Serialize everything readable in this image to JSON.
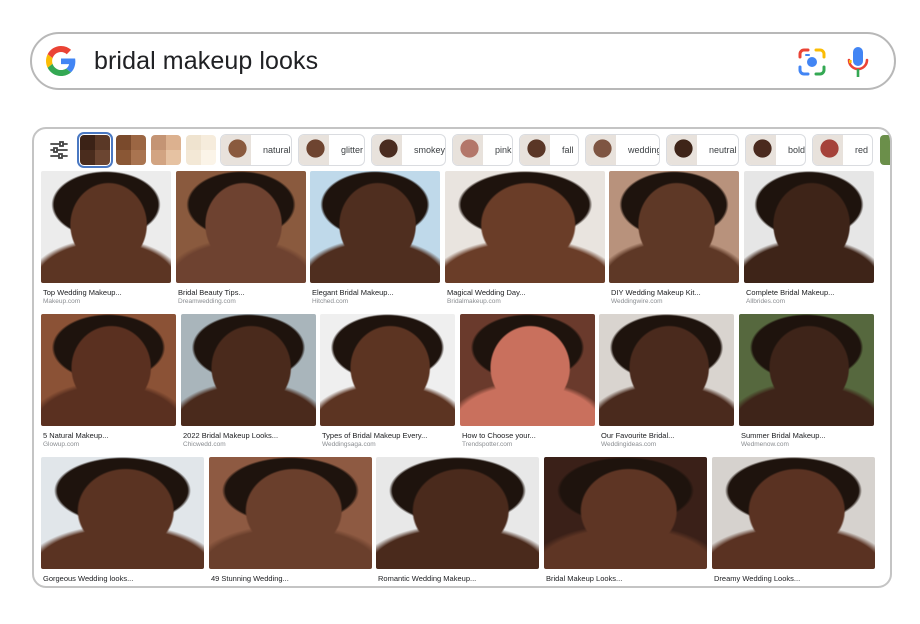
{
  "search": {
    "query": "bridal makeup looks"
  },
  "filters": {
    "tone_swatches": [
      {
        "name": "deep",
        "colors": [
          "#3b2216",
          "#5a3826",
          "#4a2c1d",
          "#6b4531"
        ],
        "selected": true
      },
      {
        "name": "brown",
        "colors": [
          "#7a4a2c",
          "#9b6643",
          "#8a5735",
          "#a97450"
        ],
        "selected": false
      },
      {
        "name": "tan",
        "colors": [
          "#c49474",
          "#dcb18f",
          "#d2a482",
          "#e6c2a2"
        ],
        "selected": false
      },
      {
        "name": "light",
        "colors": [
          "#efe3cf",
          "#f6ecdc",
          "#f3e8d6",
          "#fbf4e8"
        ],
        "selected": false
      }
    ],
    "chips": [
      {
        "label": "natural",
        "thumb": "#8a5a3e"
      },
      {
        "label": "glitter",
        "thumb": "#6e4430"
      },
      {
        "label": "smokey",
        "thumb": "#4a2c20"
      },
      {
        "label": "pink",
        "thumb": "#b3776a"
      },
      {
        "label": "fall",
        "thumb": "#5a3626"
      },
      {
        "label": "wedding",
        "thumb": "#7e5542"
      },
      {
        "label": "neutral",
        "thumb": "#3e2418"
      },
      {
        "label": "bold",
        "thumb": "#4a2a1e"
      },
      {
        "label": "red",
        "thumb": "#a5423a"
      }
    ]
  },
  "results": {
    "row1": [
      {
        "title": "Top Wedding Makeup...",
        "source": "Makeup.com",
        "bg": "#ececec",
        "skin": "#5c3523"
      },
      {
        "title": "Bridal Beauty Tips...",
        "source": "Dreamwedding.com",
        "bg": "#8a5a3e",
        "skin": "#6e4230"
      },
      {
        "title": "Elegant Bridal Makeup...",
        "source": "Hitched.com",
        "bg": "#bfd9ea",
        "skin": "#4f2e1f"
      },
      {
        "title": "Magical Wedding Day...",
        "source": "Bridalmakeup.com",
        "bg": "#e9e4df",
        "skin": "#6a3d28"
      },
      {
        "title": "DIY Wedding Makeup Kit...",
        "source": "Weddingwire.com",
        "bg": "#b8927c",
        "skin": "#5e3826"
      },
      {
        "title": "Complete Bridal Makeup...",
        "source": "Allbrides.com",
        "bg": "#e6e6e6",
        "skin": "#3e2418"
      }
    ],
    "row2": [
      {
        "title": "5 Natural Makeup...",
        "source": "Glowup.com",
        "bg": "#8b5236",
        "skin": "#5a3020"
      },
      {
        "title": "2022 Bridal Makeup Looks...",
        "source": "Chicwedd.com",
        "bg": "#a9b5bb",
        "skin": "#4a2a1c"
      },
      {
        "title": "Types of Bridal Makeup Every...",
        "source": "Weddingsaga.com",
        "bg": "#efefef",
        "skin": "#5c3422"
      },
      {
        "title": "How to Choose your...",
        "source": "Trendspotter.com",
        "bg": "#6a3a2c",
        "skin": "#c9705d"
      },
      {
        "title": "Our Favourite Bridal...",
        "source": "Weddingideas.com",
        "bg": "#d9d4cf",
        "skin": "#4a2a1d"
      },
      {
        "title": "Summer Bridal Makeup...",
        "source": "Wedmenow.com",
        "bg": "#56683e",
        "skin": "#3e2419"
      }
    ],
    "row3": [
      {
        "title": "Gorgeous Wedding looks...",
        "source": "",
        "bg": "#e1e6ea",
        "skin": "#5a3322"
      },
      {
        "title": "49 Stunning Wedding...",
        "source": "",
        "bg": "#8e5a42",
        "skin": "#6a3f2c"
      },
      {
        "title": "Romantic Wedding Makeup...",
        "source": "",
        "bg": "#e8e8e8",
        "skin": "#4a2a1c"
      },
      {
        "title": "Bridal Makeup Looks...",
        "source": "",
        "bg": "#3a2018",
        "skin": "#5e3524"
      },
      {
        "title": "Dreamy Wedding Looks...",
        "source": "",
        "bg": "#d6d2ce",
        "skin": "#5a3222"
      }
    ]
  }
}
